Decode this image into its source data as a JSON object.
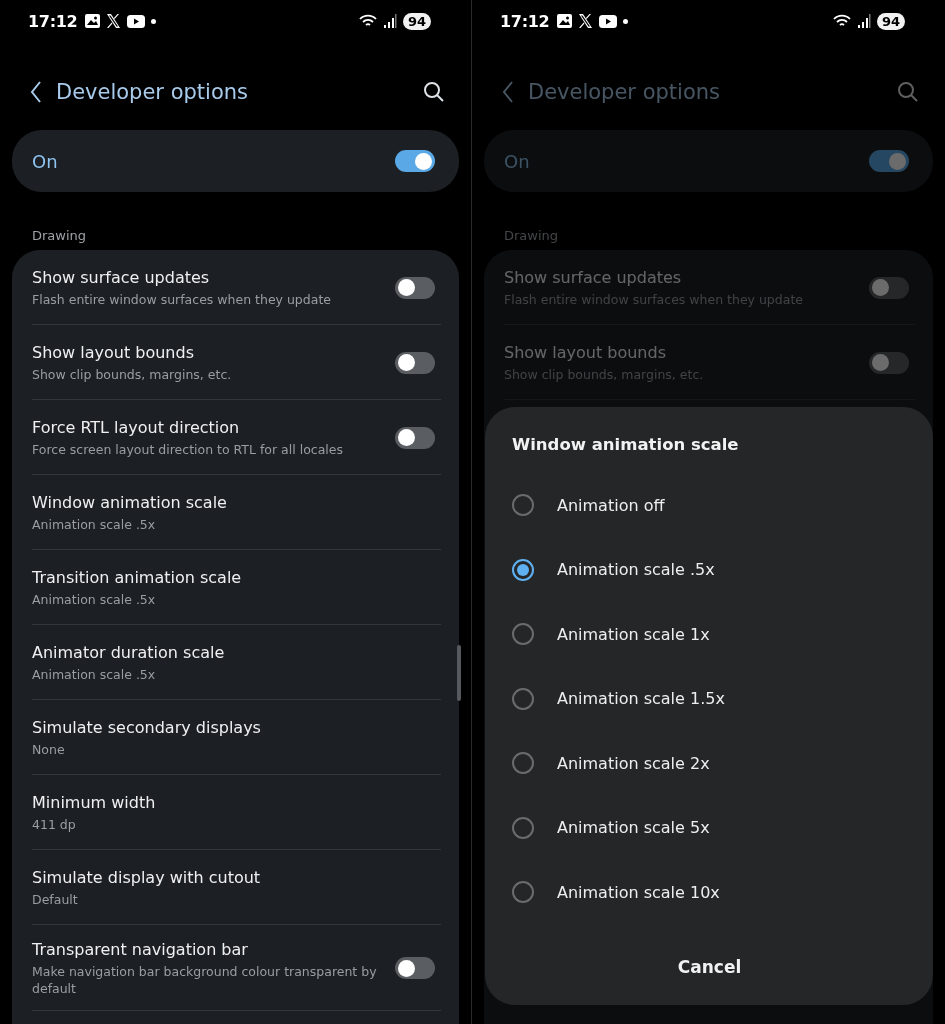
{
  "screens": [
    {
      "dimmed": false,
      "status_bar": {
        "time": "17:12",
        "battery": "94"
      },
      "title": "Developer options",
      "master": {
        "label": "On",
        "on": true
      },
      "section": "Drawing",
      "rows": [
        {
          "kind": "toggle",
          "title": "Show surface updates",
          "subtitle": "Flash entire window surfaces when they update",
          "on": false
        },
        {
          "kind": "toggle",
          "title": "Show layout bounds",
          "subtitle": "Show clip bounds, margins, etc.",
          "on": false
        },
        {
          "kind": "toggle",
          "title": "Force RTL layout direction",
          "subtitle": "Force screen layout direction to RTL for all locales",
          "on": false
        },
        {
          "kind": "value",
          "title": "Window animation scale",
          "subtitle": "Animation scale .5x"
        },
        {
          "kind": "value",
          "title": "Transition animation scale",
          "subtitle": "Animation scale .5x"
        },
        {
          "kind": "value",
          "title": "Animator duration scale",
          "subtitle": "Animation scale .5x"
        },
        {
          "kind": "value",
          "title": "Simulate secondary displays",
          "subtitle": "None"
        },
        {
          "kind": "value",
          "title": "Minimum width",
          "subtitle": "411 dp"
        },
        {
          "kind": "value",
          "title": "Simulate display with cutout",
          "subtitle": "Default"
        },
        {
          "kind": "toggle",
          "title": "Transparent navigation bar",
          "subtitle": "Make navigation bar background colour transparent by default",
          "on": false
        }
      ]
    },
    {
      "dimmed": true,
      "status_bar": {
        "time": "17:12",
        "battery": "94"
      },
      "title": "Developer options",
      "master": {
        "label": "On",
        "on": true
      },
      "section": "Drawing",
      "rows": [
        {
          "kind": "toggle",
          "title": "Show surface updates",
          "subtitle": "Flash entire window surfaces when they update",
          "on": false
        },
        {
          "kind": "toggle",
          "title": "Show layout bounds",
          "subtitle": "Show clip bounds, margins, etc.",
          "on": false
        }
      ],
      "dialog": {
        "title": "Window animation scale",
        "options": [
          {
            "label": "Animation off",
            "selected": false
          },
          {
            "label": "Animation scale .5x",
            "selected": true
          },
          {
            "label": "Animation scale 1x",
            "selected": false
          },
          {
            "label": "Animation scale 1.5x",
            "selected": false
          },
          {
            "label": "Animation scale 2x",
            "selected": false
          },
          {
            "label": "Animation scale 5x",
            "selected": false
          },
          {
            "label": "Animation scale 10x",
            "selected": false
          }
        ],
        "cancel": "Cancel"
      }
    }
  ]
}
